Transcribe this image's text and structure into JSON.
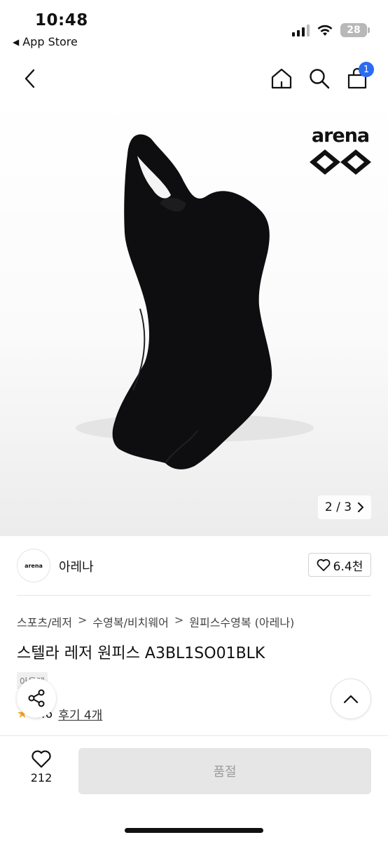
{
  "status_bar": {
    "time": "10:48",
    "back_app": "App Store",
    "battery": "28"
  },
  "nav": {
    "cart_count": "1"
  },
  "product_image": {
    "counter_text": "2 / 3",
    "logo_text": "arena"
  },
  "brand": {
    "logo_text": "arena",
    "name": "아레나",
    "like_count": "6.4천"
  },
  "breadcrumb": {
    "items": [
      "스포츠/레저",
      "수영복/비치웨어",
      "원피스수영복 (아레나)"
    ],
    "separator": ">"
  },
  "product": {
    "title": "스텔라 레저 원피스 A3BL1SO01BLK",
    "tag": "아울렛",
    "rating": "4.6",
    "review_text": "후기 4개"
  },
  "bottom_bar": {
    "wish_count": "212",
    "buy_label": "품절"
  },
  "colors": {
    "accent": "#2a6bf2",
    "star": "#f5a623",
    "disabled_bg": "#e6e6e6"
  }
}
